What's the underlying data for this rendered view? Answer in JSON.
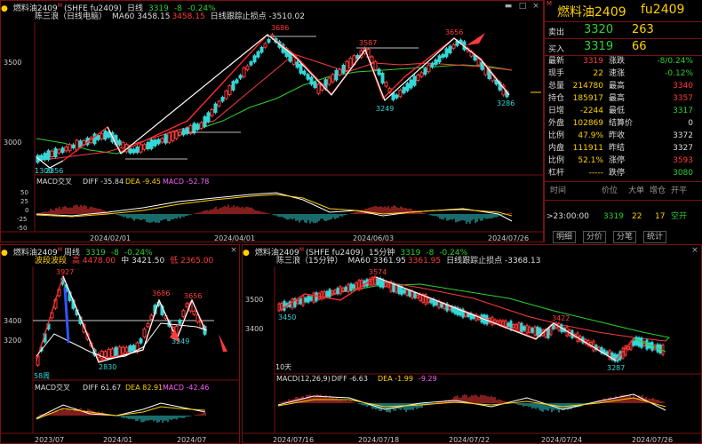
{
  "colors": {
    "up": "#ff3b3b",
    "down": "#34d6d6",
    "ma": "#2ed12e",
    "bg": "#000000",
    "grid": "#7a1010",
    "title": "#ffd000"
  },
  "daily": {
    "header": {
      "dot": "●",
      "name": "燃料油2409",
      "sup": "M",
      "code": "(SHFE fu2409)",
      "period": "日线",
      "price": "3319",
      "change": "-8",
      "pct": "-0.24%"
    },
    "subheader": {
      "indicator": "陈三浪（日线电脑）",
      "ma": "MA60 3458.15",
      "val": "3458.15",
      "stop": "日线跟踪止损点 -3510.02"
    },
    "yticks": [
      "3500",
      "3000"
    ],
    "labels": [
      "3686",
      "3587",
      "3656",
      "3249",
      "3286",
      "1300",
      "2856"
    ],
    "macd": {
      "title": "MACD交叉",
      "diff": "DIFF -35.84",
      "dea": "DEA -9.45",
      "macd": "MACD -52.78",
      "yticks": [
        "50",
        "25",
        "0",
        "-25",
        "-50"
      ]
    },
    "dates": [
      "2024/02/01",
      "2024/04/01",
      "2024/06/03",
      "2024/07/26"
    ]
  },
  "weekly": {
    "header": {
      "dot": "●",
      "name": "燃料油2409",
      "sup": "M",
      "period": "周线",
      "price": "3319",
      "change": "-8",
      "pct": "-0.24%"
    },
    "subheader": {
      "indicator": "波段波段",
      "high": "高 4478.00",
      "mid": "中 3421.50",
      "low": "低 2365.00"
    },
    "yticks": [
      "3400",
      "3200"
    ],
    "labels": [
      "3927",
      "3686",
      "3656",
      "3249",
      "2830",
      "58周"
    ],
    "macd": {
      "title": "MACD交叉",
      "diff": "DIFF 61.67",
      "dea": "DEA 82.91",
      "macd": "MACD -42.46"
    },
    "dates": [
      "2023/07",
      "2024/01",
      "2024/07"
    ]
  },
  "min15": {
    "header": {
      "dot": "●",
      "name": "燃料油2409",
      "sup": "M",
      "code": "(SHFE fu2409)",
      "period": "15分钟",
      "price": "3319",
      "change": "-8",
      "pct": "-0.24%"
    },
    "subheader": {
      "indicator": "陈三浪（15分钟）",
      "ma": "MA60 3361.95",
      "val": "3361.95",
      "stop": "日线跟踪止损点 -3368.13"
    },
    "yticks": [
      "3500",
      "3400"
    ],
    "labels": [
      "3574",
      "3422",
      "3450",
      "3287",
      "10天"
    ],
    "macd": {
      "title": "MACD(12,26,9)",
      "diff": "DIFF -6.63",
      "dea": "DEA -1.99",
      "macd": "-9.29"
    },
    "dates": [
      "2024/07/16",
      "2024/07/18",
      "2024/07/22",
      "2024/07/24",
      "2024/07/26"
    ]
  },
  "quote": {
    "title": "燃料油2409",
    "code": "fu2409",
    "marker": "M",
    "sell": {
      "label": "卖出",
      "price": "3320",
      "vol": "263"
    },
    "buy": {
      "label": "买入",
      "price": "3319",
      "vol": "66"
    },
    "stats": [
      {
        "l1": "最新",
        "v1": "3319",
        "c1": "#ff3b3b",
        "l2": "涨跌",
        "v2": "-8/0.24%",
        "c2": "#2ed12e"
      },
      {
        "l1": "现手",
        "v1": "22",
        "c1": "#ffd000",
        "l2": "速涨",
        "v2": "-0.12%",
        "c2": "#2ed12e"
      },
      {
        "l1": "总量",
        "v1": "214780",
        "c1": "#ffd000",
        "l2": "最高",
        "v2": "3340",
        "c2": "#ff3b3b"
      },
      {
        "l1": "持仓",
        "v1": "185917",
        "c1": "#ffd000",
        "l2": "最高",
        "v2": "3357",
        "c2": "#ff3b3b"
      },
      {
        "l1": "日增",
        "v1": "-2244",
        "c1": "#ffd000",
        "l2": "最低",
        "v2": "3317",
        "c2": "#2ed12e"
      },
      {
        "l1": "外盘",
        "v1": "102869",
        "c1": "#ffd000",
        "l2": "结算价",
        "v2": "0",
        "c2": "#dddddd"
      },
      {
        "l1": "比例",
        "v1": "47.9%",
        "c1": "#ffd000",
        "l2": "昨收",
        "v2": "3372",
        "c2": "#dddddd"
      },
      {
        "l1": "内盘",
        "v1": "111911",
        "c1": "#ffd000",
        "l2": "昨结",
        "v2": "3327",
        "c2": "#dddddd"
      },
      {
        "l1": "比例",
        "v1": "52.1%",
        "c1": "#ffd000",
        "l2": "涨停",
        "v2": "3593",
        "c2": "#ff3b3b"
      },
      {
        "l1": "杠杆",
        "v1": "-----",
        "c1": "#ffd000",
        "l2": "跌停",
        "v2": "3080",
        "c2": "#2ed12e"
      }
    ],
    "tick_header": [
      "时间",
      "价位",
      "大单",
      "增仓",
      "开平"
    ],
    "tick": {
      "time": ">23:00:00",
      "price": "3319",
      "vol": "22",
      "oi": "17",
      "type": "空开"
    },
    "tabs": [
      "明细",
      "分价",
      "分笔",
      "统计"
    ]
  }
}
